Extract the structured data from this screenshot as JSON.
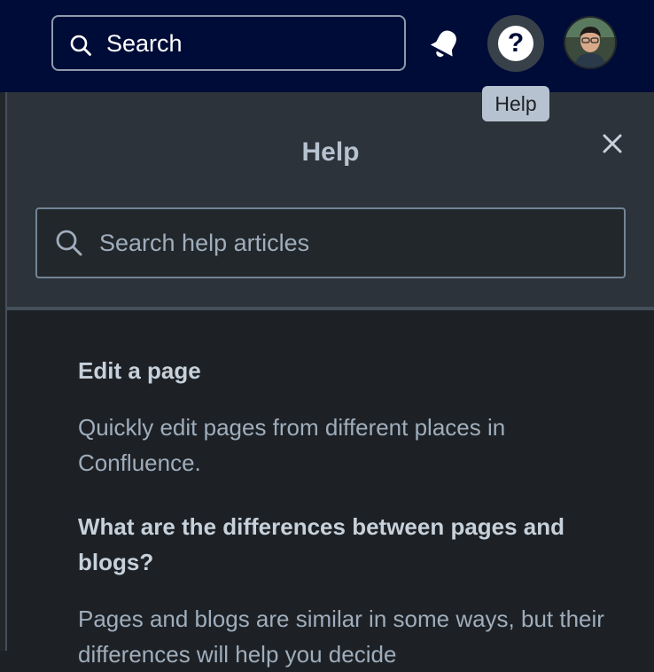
{
  "topbar": {
    "search_label": "Search",
    "help_glyph": "?",
    "icons": {
      "search": "search-icon",
      "notifications": "bell-icon",
      "help": "help-icon",
      "avatar": "user-avatar"
    }
  },
  "tooltip": {
    "text": "Help"
  },
  "help_panel": {
    "title": "Help",
    "search_placeholder": "Search help articles",
    "articles": [
      {
        "title": "Edit a page",
        "description": "Quickly edit pages from different places in Confluence."
      },
      {
        "title": "What are the differences between pages and blogs?",
        "description": "Pages and blogs are similar in some ways, but their differences will help you decide"
      }
    ]
  },
  "colors": {
    "topbar_bg": "#000c38",
    "panel_header_bg": "#2c333a",
    "panel_body_bg": "#1d2125",
    "text_primary": "#c7d1db",
    "text_secondary": "#9fadbc"
  }
}
